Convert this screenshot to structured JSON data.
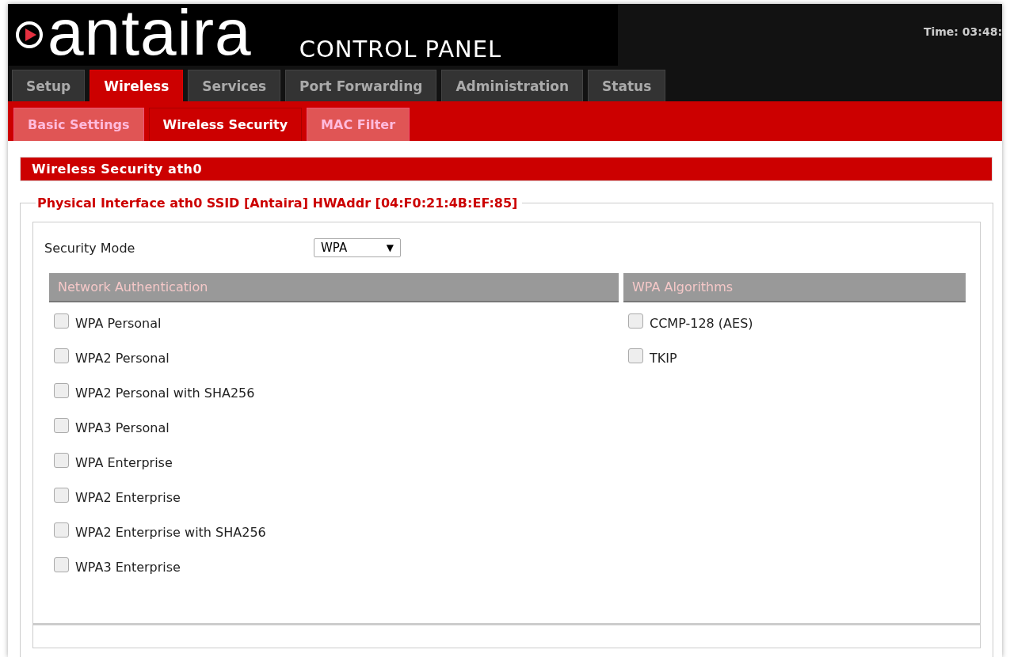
{
  "header": {
    "logo": "antaira",
    "subtitle": "CONTROL PANEL",
    "time": "Time: 03:48:"
  },
  "tabs": [
    {
      "label": "Setup",
      "selected": false
    },
    {
      "label": "Wireless",
      "selected": true
    },
    {
      "label": "Services",
      "selected": false
    },
    {
      "label": "Port Forwarding",
      "selected": false
    },
    {
      "label": "Administration",
      "selected": false
    },
    {
      "label": "Status",
      "selected": false
    }
  ],
  "subtabs": [
    {
      "label": "Basic Settings",
      "selected": false
    },
    {
      "label": "Wireless Security",
      "selected": true
    },
    {
      "label": "MAC Filter",
      "selected": false
    }
  ],
  "section_title": "Wireless Security ath0",
  "fieldset_legend": "Physical Interface ath0 SSID [Antaira] HWAddr [04:F0:21:4B:EF:85]",
  "security_mode": {
    "label": "Security Mode",
    "value": "WPA",
    "arrow": "▼"
  },
  "network_authentication": {
    "heading": "Network Authentication",
    "options": [
      {
        "label": "WPA Personal",
        "checked": false
      },
      {
        "label": "WPA2 Personal",
        "checked": false
      },
      {
        "label": "WPA2 Personal with SHA256",
        "checked": false
      },
      {
        "label": "WPA3 Personal",
        "checked": false
      },
      {
        "label": "WPA Enterprise",
        "checked": false
      },
      {
        "label": "WPA2 Enterprise",
        "checked": false
      },
      {
        "label": "WPA2 Enterprise with SHA256",
        "checked": false
      },
      {
        "label": "WPA3 Enterprise",
        "checked": false
      }
    ]
  },
  "wpa_algorithms": {
    "heading": "WPA Algorithms",
    "options": [
      {
        "label": "CCMP-128 (AES)",
        "checked": false
      },
      {
        "label": "TKIP",
        "checked": false
      }
    ]
  }
}
